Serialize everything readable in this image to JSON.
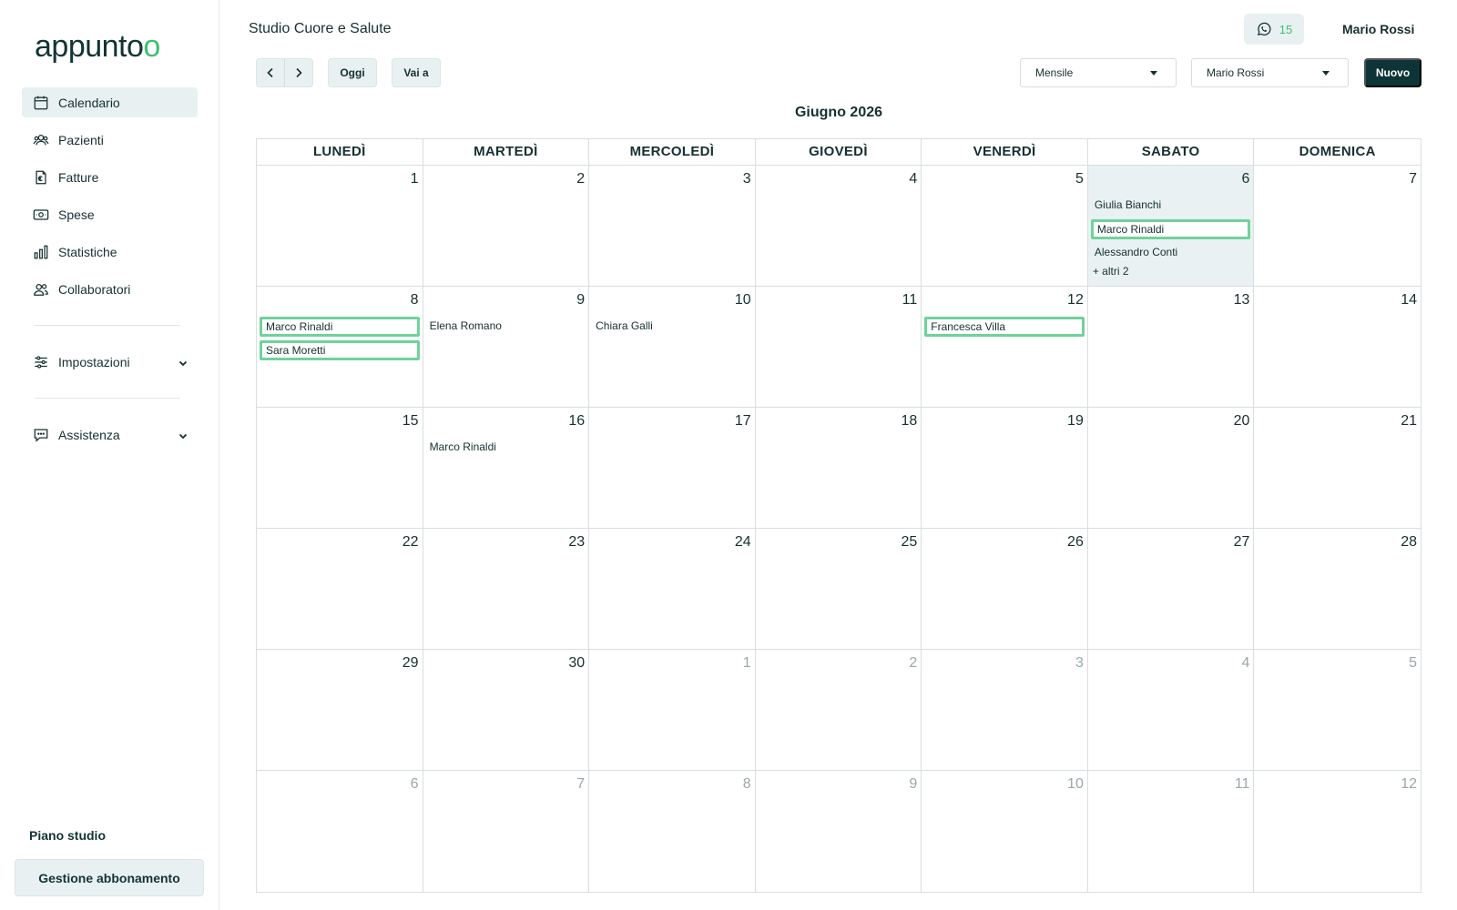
{
  "sidebar": {
    "logo": "appuntoo",
    "nav": [
      {
        "label": "Calendario",
        "icon": "calendar-icon",
        "active": true
      },
      {
        "label": "Pazienti",
        "icon": "users-icon"
      },
      {
        "label": "Fatture",
        "icon": "invoice-icon"
      },
      {
        "label": "Spese",
        "icon": "money-icon"
      },
      {
        "label": "Statistiche",
        "icon": "bar-chart-icon"
      },
      {
        "label": "Collaboratori",
        "icon": "collaborators-icon"
      }
    ],
    "settings_label": "Impostazioni",
    "support_label": "Assistenza",
    "plan_label": "Piano studio",
    "plan_button": "Gestione abbonamento"
  },
  "header": {
    "studio": "Studio Cuore e Salute",
    "whatsapp_count": "15",
    "user_name": "Mario Rossi"
  },
  "toolbar": {
    "today_label": "Oggi",
    "goto_label": "Vai a",
    "view_select": "Mensile",
    "user_select": "Mario Rossi",
    "new_label": "Nuovo"
  },
  "calendar": {
    "month_title": "Giugno 2026",
    "weekdays": [
      "LUNEDÌ",
      "MARTEDÌ",
      "MERCOLEDÌ",
      "GIOVEDÌ",
      "VENERDÌ",
      "SABATO",
      "DOMENICA"
    ],
    "cells": [
      {
        "day": "1"
      },
      {
        "day": "2"
      },
      {
        "day": "3"
      },
      {
        "day": "4"
      },
      {
        "day": "5"
      },
      {
        "day": "6",
        "today": true,
        "events": [
          {
            "name": "Giulia Bianchi"
          },
          {
            "name": "Marco Rinaldi",
            "boxed": true
          },
          {
            "name": "Alessandro Conti"
          }
        ],
        "more": "+ altri 2"
      },
      {
        "day": "7"
      },
      {
        "day": "8",
        "events": [
          {
            "name": "Marco Rinaldi",
            "boxed": true
          },
          {
            "name": "Sara Moretti",
            "boxed": true
          }
        ]
      },
      {
        "day": "9",
        "events": [
          {
            "name": "Elena Romano"
          }
        ]
      },
      {
        "day": "10",
        "events": [
          {
            "name": "Chiara Galli"
          }
        ]
      },
      {
        "day": "11"
      },
      {
        "day": "12",
        "events": [
          {
            "name": "Francesca Villa",
            "boxed": true
          }
        ]
      },
      {
        "day": "13"
      },
      {
        "day": "14"
      },
      {
        "day": "15"
      },
      {
        "day": "16",
        "events": [
          {
            "name": "Marco Rinaldi"
          }
        ]
      },
      {
        "day": "17"
      },
      {
        "day": "18"
      },
      {
        "day": "19"
      },
      {
        "day": "20"
      },
      {
        "day": "21"
      },
      {
        "day": "22"
      },
      {
        "day": "23"
      },
      {
        "day": "24"
      },
      {
        "day": "25"
      },
      {
        "day": "26"
      },
      {
        "day": "27"
      },
      {
        "day": "28"
      },
      {
        "day": "29"
      },
      {
        "day": "30"
      },
      {
        "day": "1",
        "other": true
      },
      {
        "day": "2",
        "other": true
      },
      {
        "day": "3",
        "other": true
      },
      {
        "day": "4",
        "other": true
      },
      {
        "day": "5",
        "other": true
      },
      {
        "day": "6",
        "other": true
      },
      {
        "day": "7",
        "other": true
      },
      {
        "day": "8",
        "other": true
      },
      {
        "day": "9",
        "other": true
      },
      {
        "day": "10",
        "other": true
      },
      {
        "day": "11",
        "other": true
      },
      {
        "day": "12",
        "other": true
      }
    ]
  },
  "colors": {
    "brand_dark": "#0e3437",
    "accent_green": "#3fbf73",
    "event_border": "#6fd39a",
    "today_bg": "#e9f1f2"
  }
}
